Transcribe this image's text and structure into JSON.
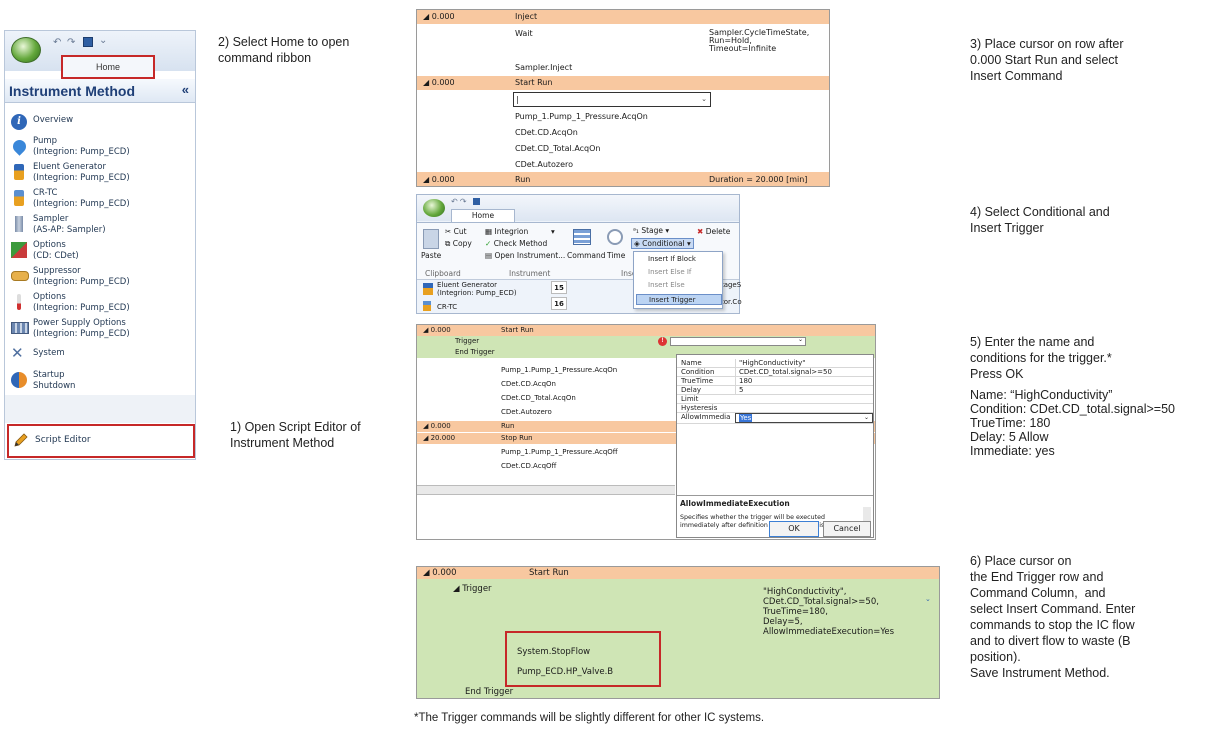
{
  "left_panel": {
    "home_tab": "Home",
    "title": "Instrument Method",
    "collapse_glyph": "«",
    "items": [
      {
        "label": "Overview",
        "icon": "info-icon"
      },
      {
        "label": "Pump\n(Integrion: Pump_ECD)",
        "icon": "pump-icon"
      },
      {
        "label": "Eluent Generator\n(Integrion: Pump_ECD)",
        "icon": "eluent-generator-icon"
      },
      {
        "label": "CR-TC\n(Integrion: Pump_ECD)",
        "icon": "cr-tc-icon"
      },
      {
        "label": "Sampler\n(AS-AP: Sampler)",
        "icon": "sampler-icon"
      },
      {
        "label": "Options\n(CD: CDet)",
        "icon": "options-icon"
      },
      {
        "label": "Suppressor\n(Integrion: Pump_ECD)",
        "icon": "suppressor-icon"
      },
      {
        "label": "Options\n(Integrion: Pump_ECD)",
        "icon": "options-thermo-icon"
      },
      {
        "label": "Power Supply Options\n(Integrion: Pump_ECD)",
        "icon": "power-supply-icon"
      },
      {
        "label": "System",
        "icon": "system-icon"
      },
      {
        "label": "Startup\nShutdown",
        "icon": "startup-icon"
      }
    ],
    "script_editor": "Script Editor"
  },
  "steps": {
    "s1": "1) Open Script Editor of\nInstrument Method",
    "s2": "2) Select Home to open\ncommand ribbon",
    "s3": "3) Place cursor on row after\n0.000 Start Run and select\nInsert Command",
    "s4": "4) Select Conditional and\nInsert Trigger",
    "s5": "5) Enter the name and\nconditions for the trigger.*\nPress OK",
    "s5_details": "Name: “HighConductivity”\nCondition: CDet.CD_total.signal>=50\nTrueTime: 180\nDelay: 5 Allow\nImmediate: yes",
    "s6": "6) Place cursor on\nthe End Trigger row and\nCommand Column,  and\nselect Insert Command. Enter\ncommands to stop the IC flow\nand to divert flow to waste (B\nposition).\nSave Instrument Method."
  },
  "footnote": "*The Trigger commands will be slightly different for other IC systems.",
  "panel1": {
    "r1_time": "◢ 0.000",
    "r1_cmd": "Inject",
    "r2_cmd": "Wait",
    "r2_args": "Sampler.CycleTimeState,\nRun=Hold,\nTimeout=Infinite",
    "r3_cmd": "Sampler.Inject",
    "r4_time": "◢ 0.000",
    "r4_cmd": "Start Run",
    "r5_input": "|",
    "r6_cmd": "Pump_1.Pump_1_Pressure.AcqOn",
    "r7_cmd": "CDet.CD.AcqOn",
    "r8_cmd": "CDet.CD_Total.AcqOn",
    "r9_cmd": "CDet.Autozero",
    "r10_time": "◢ 0.000",
    "r10_cmd": "Run",
    "r10_args": "Duration = 20.000 [min]"
  },
  "ribbon": {
    "tab": "Home",
    "cut": "Cut",
    "copy": "Copy",
    "paste": "Paste",
    "clipboard": "Clipboard",
    "integrion": "Integrion",
    "check_method": "Check Method",
    "open_instrument": "Open Instrument...",
    "instrument_group": "Instrument",
    "command": "Command",
    "time": "Time",
    "insert_group": "Inse",
    "stage": "Stage",
    "conditional": "Conditional",
    "delete": "Delete",
    "menu": [
      "Insert If Block",
      "Insert Else If",
      "Insert Else",
      "Insert Trigger"
    ],
    "bg_item": "Eluent Generator\n(Integrion: Pump_ECD)",
    "bg_item2": "CR-TC",
    "bg_num1": "15",
    "bg_num2": "16",
    "bg_right": "ltageS",
    "bg_right2": "ltor.Co"
  },
  "panel3": {
    "r1_time": "◢ 0.000",
    "r1_cmd": "Start Run",
    "r2_cmd": "Trigger",
    "r3_cmd": "End Trigger",
    "r4_cmd": "Pump_1.Pump_1_Pressure.AcqOn",
    "r5_cmd": "CDet.CD.AcqOn",
    "r6_cmd": "CDet.CD_Total.AcqOn",
    "r7_cmd": "CDet.Autozero",
    "r8_time": "◢ 0.000",
    "r8_cmd": "Run",
    "r9_time": "◢ 20.000",
    "r9_cmd": "Stop Run",
    "r10_cmd": "Pump_1.Pump_1_Pressure.AcqOff",
    "r11_cmd": "CDet.CD.AcqOff",
    "props": [
      {
        "k": "Name",
        "v": "\"HighConductivity\""
      },
      {
        "k": "Condition",
        "v": "CDet.CD_total.signal>=50"
      },
      {
        "k": "TrueTime",
        "v": "180"
      },
      {
        "k": "Delay",
        "v": "5"
      },
      {
        "k": "Limit",
        "v": ""
      },
      {
        "k": "Hysteresis",
        "v": ""
      },
      {
        "k": "AllowImmedia",
        "v": "Yes"
      }
    ],
    "desc_title": "AllowImmediateExecution",
    "desc_text": "Specifies whether the trigger will be executed\nimmediately after definition if the condition is true.",
    "ok": "OK",
    "cancel": "Cancel"
  },
  "panel4": {
    "r1_time": "◢ 0.000",
    "r1_cmd": "Start Run",
    "r2_cmd": "◢ Trigger",
    "r2_args": "\"HighConductivity\",\nCDet.CD_Total.signal>=50,\nTrueTime=180,\nDelay=5,\nAllowImmediateExecution=Yes",
    "cmd1": "System.StopFlow",
    "cmd2": "Pump_ECD.HP_Valve.B",
    "end": "End Trigger"
  },
  "colors": {
    "run_row": "#f8c8a0",
    "trigger_row": "#cfe5b5",
    "highlight_box": "#c62828",
    "ribbon_accent": "#1f3f77"
  }
}
